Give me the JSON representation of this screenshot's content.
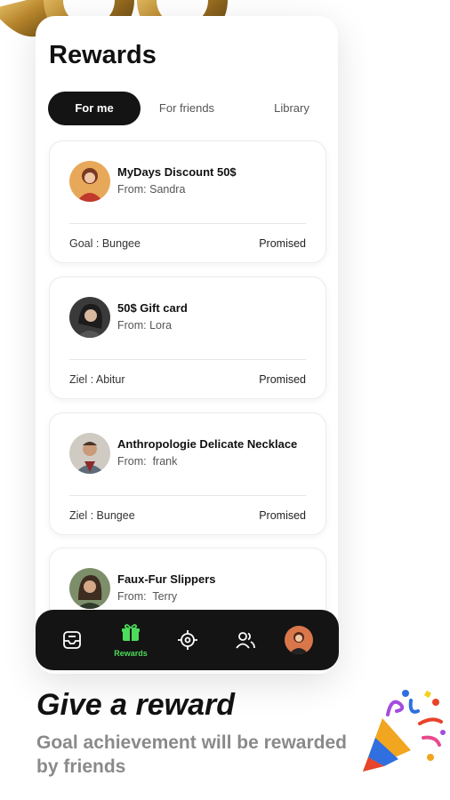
{
  "screen": {
    "title": "Rewards"
  },
  "tabs": [
    {
      "label": "For me",
      "active": true
    },
    {
      "label": "For friends",
      "active": false
    },
    {
      "label": "Library",
      "active": false
    }
  ],
  "rewards": [
    {
      "title": "MyDays Discount 50$",
      "from": "From: Sandra",
      "goal": "Goal : Bungee",
      "status": "Promised",
      "avatar": "avatar-sandra"
    },
    {
      "title": "50$ Gift card",
      "from": "From: Lora",
      "goal": "Ziel : Abitur",
      "status": "Promised",
      "avatar": "avatar-lora"
    },
    {
      "title": "Anthropologie Delicate Necklace",
      "from": "From:  frank",
      "goal": "Ziel : Bungee",
      "status": "Promised",
      "avatar": "avatar-frank"
    },
    {
      "title": "Faux-Fur Slippers",
      "from": "From:  Terry",
      "avatar": "avatar-terry"
    }
  ],
  "nav": {
    "items": [
      {
        "icon": "inbox-icon",
        "active": false
      },
      {
        "icon": "gift-icon",
        "label": "Rewards",
        "active": true
      },
      {
        "icon": "target-icon",
        "active": false
      },
      {
        "icon": "friends-icon",
        "active": false
      },
      {
        "icon": "profile-avatar",
        "active": false
      }
    ],
    "active_color": "#4cdc5b"
  },
  "promo": {
    "headline": "Give a reward",
    "subline": "Goal achievement will be rewarded by friends"
  },
  "colors": {
    "accent": "#4cdc5b",
    "dark": "#141414",
    "muted_text": "#8a8a8a"
  }
}
